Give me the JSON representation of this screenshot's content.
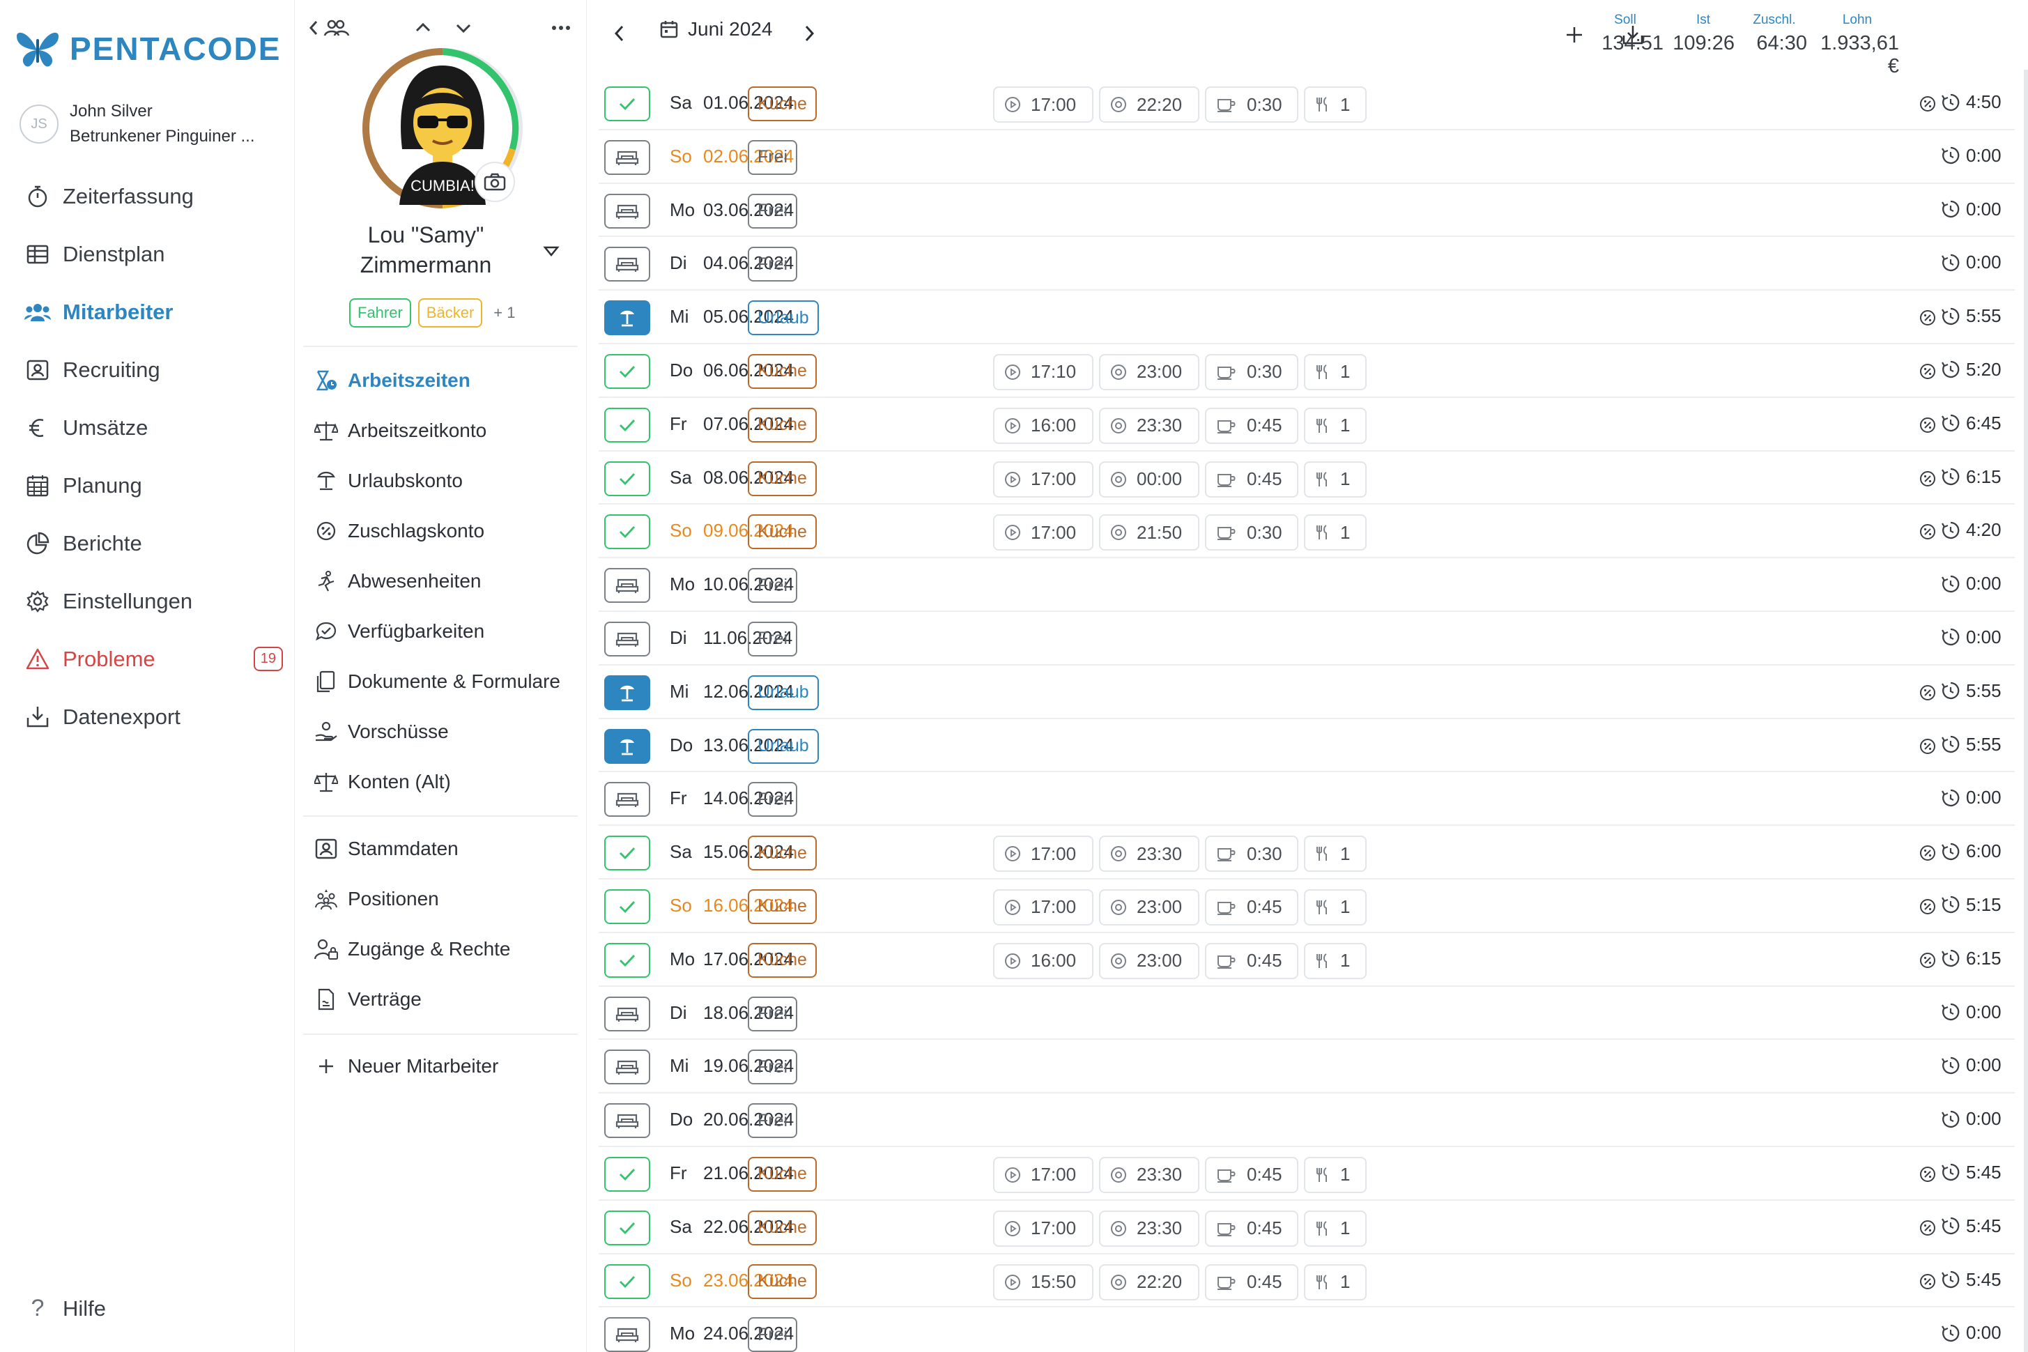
{
  "app": {
    "brand": "PENTACODE",
    "brand_color": "#2e86c1"
  },
  "user": {
    "initials": "JS",
    "name": "John Silver",
    "company": "Betrunkener Pinguiner ..."
  },
  "nav": {
    "items": [
      {
        "label": "Zeiterfassung",
        "icon": "stopwatch-icon"
      },
      {
        "label": "Dienstplan",
        "icon": "table-icon"
      },
      {
        "label": "Mitarbeiter",
        "icon": "users-icon",
        "active": true
      },
      {
        "label": "Recruiting",
        "icon": "id-card-icon"
      },
      {
        "label": "Umsätze",
        "icon": "euro-icon"
      },
      {
        "label": "Planung",
        "icon": "calendar-icon"
      },
      {
        "label": "Berichte",
        "icon": "pie-chart-icon"
      },
      {
        "label": "Einstellungen",
        "icon": "gear-icon"
      },
      {
        "label": "Probleme",
        "icon": "warning-icon",
        "badge": "19"
      },
      {
        "label": "Datenexport",
        "icon": "download-icon"
      }
    ],
    "help": "Hilfe"
  },
  "profile": {
    "name_line1": "Lou \"Samy\"",
    "name_line2": "Zimmermann",
    "avatar_shirt": "CUMBIA!",
    "tags": [
      "Fahrer",
      "Bäcker",
      "+ 1"
    ],
    "menu_a": [
      {
        "label": "Arbeitszeiten",
        "icon": "work-time-icon",
        "active": true
      },
      {
        "label": "Arbeitszeitkonto",
        "icon": "balance-icon"
      },
      {
        "label": "Urlaubskonto",
        "icon": "beach-icon"
      },
      {
        "label": "Zuschlagskonto",
        "icon": "surcharge-icon"
      },
      {
        "label": "Abwesenheiten",
        "icon": "absence-icon"
      },
      {
        "label": "Verfügbarkeiten",
        "icon": "chat-check-icon"
      },
      {
        "label": "Dokumente & Formulare",
        "icon": "documents-icon"
      },
      {
        "label": "Vorschüsse",
        "icon": "advance-icon"
      },
      {
        "label": "Konten (Alt)",
        "icon": "balance-icon"
      }
    ],
    "menu_b": [
      {
        "label": "Stammdaten",
        "icon": "id-card-icon"
      },
      {
        "label": "Positionen",
        "icon": "positions-icon"
      },
      {
        "label": "Zugänge & Rechte",
        "icon": "user-lock-icon"
      },
      {
        "label": "Verträge",
        "icon": "contract-icon"
      }
    ],
    "new_employee": "Neuer Mitarbeiter"
  },
  "header": {
    "month": "Juni 2024",
    "stats": [
      {
        "label": "Soll",
        "value": "134:51"
      },
      {
        "label": "Ist",
        "value": "109:26"
      },
      {
        "label": "Zuschl.",
        "value": "64:30"
      },
      {
        "label": "Lohn",
        "value": "1.933,61 €"
      }
    ]
  },
  "colors": {
    "check": "#32c36c",
    "vacation": "#2e86c1",
    "kitchen": "#b96a2b",
    "sunday": "#e8891e"
  },
  "rows": [
    {
      "day": "Sa",
      "date": "01.06.2024",
      "status": "check",
      "type": "Küche",
      "start": "17:00",
      "end": "22:20",
      "pause": "0:30",
      "meals": "1",
      "total": "4:50"
    },
    {
      "day": "So",
      "date": "02.06.2024",
      "status": "free",
      "type": "Frei",
      "total": "0:00",
      "sunday": true
    },
    {
      "day": "Mo",
      "date": "03.06.2024",
      "status": "free",
      "type": "Frei",
      "total": "0:00"
    },
    {
      "day": "Di",
      "date": "04.06.2024",
      "status": "free",
      "type": "Frei",
      "total": "0:00"
    },
    {
      "day": "Mi",
      "date": "05.06.2024",
      "status": "vacation",
      "type": "Urlaub",
      "total": "5:55"
    },
    {
      "day": "Do",
      "date": "06.06.2024",
      "status": "check",
      "type": "Küche",
      "start": "17:10",
      "end": "23:00",
      "pause": "0:30",
      "meals": "1",
      "total": "5:20"
    },
    {
      "day": "Fr",
      "date": "07.06.2024",
      "status": "check",
      "type": "Küche",
      "start": "16:00",
      "end": "23:30",
      "pause": "0:45",
      "meals": "1",
      "total": "6:45"
    },
    {
      "day": "Sa",
      "date": "08.06.2024",
      "status": "check",
      "type": "Küche",
      "start": "17:00",
      "end": "00:00",
      "pause": "0:45",
      "meals": "1",
      "total": "6:15"
    },
    {
      "day": "So",
      "date": "09.06.2024",
      "status": "check",
      "type": "Küche",
      "start": "17:00",
      "end": "21:50",
      "pause": "0:30",
      "meals": "1",
      "total": "4:20",
      "sunday": true
    },
    {
      "day": "Mo",
      "date": "10.06.2024",
      "status": "free",
      "type": "Frei",
      "total": "0:00"
    },
    {
      "day": "Di",
      "date": "11.06.2024",
      "status": "free",
      "type": "Frei",
      "total": "0:00"
    },
    {
      "day": "Mi",
      "date": "12.06.2024",
      "status": "vacation",
      "type": "Urlaub",
      "total": "5:55"
    },
    {
      "day": "Do",
      "date": "13.06.2024",
      "status": "vacation",
      "type": "Urlaub",
      "total": "5:55"
    },
    {
      "day": "Fr",
      "date": "14.06.2024",
      "status": "free",
      "type": "Frei",
      "total": "0:00"
    },
    {
      "day": "Sa",
      "date": "15.06.2024",
      "status": "check",
      "type": "Küche",
      "start": "17:00",
      "end": "23:30",
      "pause": "0:30",
      "meals": "1",
      "total": "6:00"
    },
    {
      "day": "So",
      "date": "16.06.2024",
      "status": "check",
      "type": "Küche",
      "start": "17:00",
      "end": "23:00",
      "pause": "0:45",
      "meals": "1",
      "total": "5:15",
      "sunday": true
    },
    {
      "day": "Mo",
      "date": "17.06.2024",
      "status": "check",
      "type": "Küche",
      "start": "16:00",
      "end": "23:00",
      "pause": "0:45",
      "meals": "1",
      "total": "6:15"
    },
    {
      "day": "Di",
      "date": "18.06.2024",
      "status": "free",
      "type": "Frei",
      "total": "0:00"
    },
    {
      "day": "Mi",
      "date": "19.06.2024",
      "status": "free",
      "type": "Frei",
      "total": "0:00"
    },
    {
      "day": "Do",
      "date": "20.06.2024",
      "status": "free",
      "type": "Frei",
      "total": "0:00"
    },
    {
      "day": "Fr",
      "date": "21.06.2024",
      "status": "check",
      "type": "Küche",
      "start": "17:00",
      "end": "23:30",
      "pause": "0:45",
      "meals": "1",
      "total": "5:45"
    },
    {
      "day": "Sa",
      "date": "22.06.2024",
      "status": "check",
      "type": "Küche",
      "start": "17:00",
      "end": "23:30",
      "pause": "0:45",
      "meals": "1",
      "total": "5:45"
    },
    {
      "day": "So",
      "date": "23.06.2024",
      "status": "check",
      "type": "Küche",
      "start": "15:50",
      "end": "22:20",
      "pause": "0:45",
      "meals": "1",
      "total": "5:45",
      "sunday": true
    },
    {
      "day": "Mo",
      "date": "24.06.2024",
      "status": "free",
      "type": "Frei",
      "total": "0:00"
    }
  ]
}
